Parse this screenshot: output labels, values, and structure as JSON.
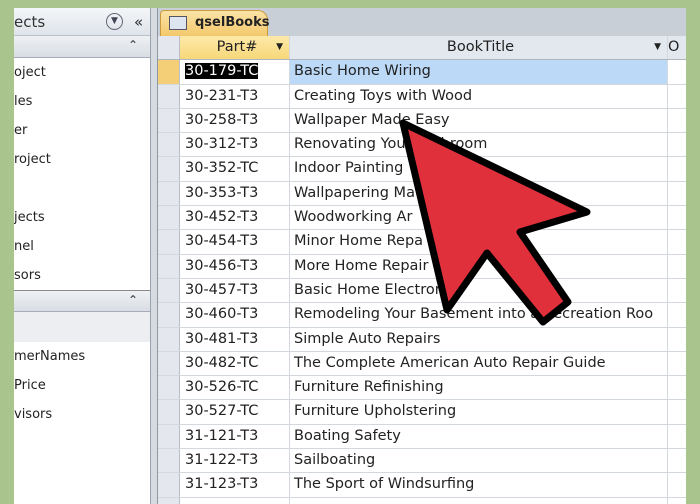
{
  "nav": {
    "header": "ects",
    "section1_items": [
      "oject",
      "les",
      "er",
      "roject",
      "",
      "jects",
      "nel",
      "sors"
    ],
    "section2_items": [
      "merNames",
      "Price",
      "visors"
    ]
  },
  "tab": {
    "label": "qselBooks"
  },
  "grid": {
    "columns": [
      "Part#",
      "BookTitle",
      "O"
    ],
    "rows": [
      [
        "30-179-TC",
        "Basic Home Wiring"
      ],
      [
        "30-231-T3",
        "Creating Toys with Wood"
      ],
      [
        "30-258-T3",
        "Wallpaper Made Easy"
      ],
      [
        "30-312-T3",
        "Renovating Your Bathroom"
      ],
      [
        "30-352-TC",
        "Indoor Painting"
      ],
      [
        "30-353-T3",
        "Wallpapering Ma"
      ],
      [
        "30-452-T3",
        "Woodworking Ar"
      ],
      [
        "30-454-T3",
        "Minor Home Repa"
      ],
      [
        "30-456-T3",
        "More Home Repair"
      ],
      [
        "30-457-T3",
        "Basic Home Electron"
      ],
      [
        "30-460-T3",
        "Remodeling Your Basement into a Recreation Roo"
      ],
      [
        "30-481-T3",
        "Simple Auto Repairs"
      ],
      [
        "30-482-TC",
        "The Complete American Auto Repair Guide"
      ],
      [
        "30-526-TC",
        "Furniture Refinishing"
      ],
      [
        "30-527-TC",
        "Furniture Upholstering"
      ],
      [
        "31-121-T3",
        "Boating Safety"
      ],
      [
        "31-122-T3",
        "Sailboating"
      ],
      [
        "31-123-T3",
        "The Sport of Windsurfing"
      ]
    ]
  },
  "colors": {
    "arrow": "#e0303c",
    "accent": "#f3c86b",
    "selection": "#bcd9f7",
    "background": "#a9c48c"
  }
}
